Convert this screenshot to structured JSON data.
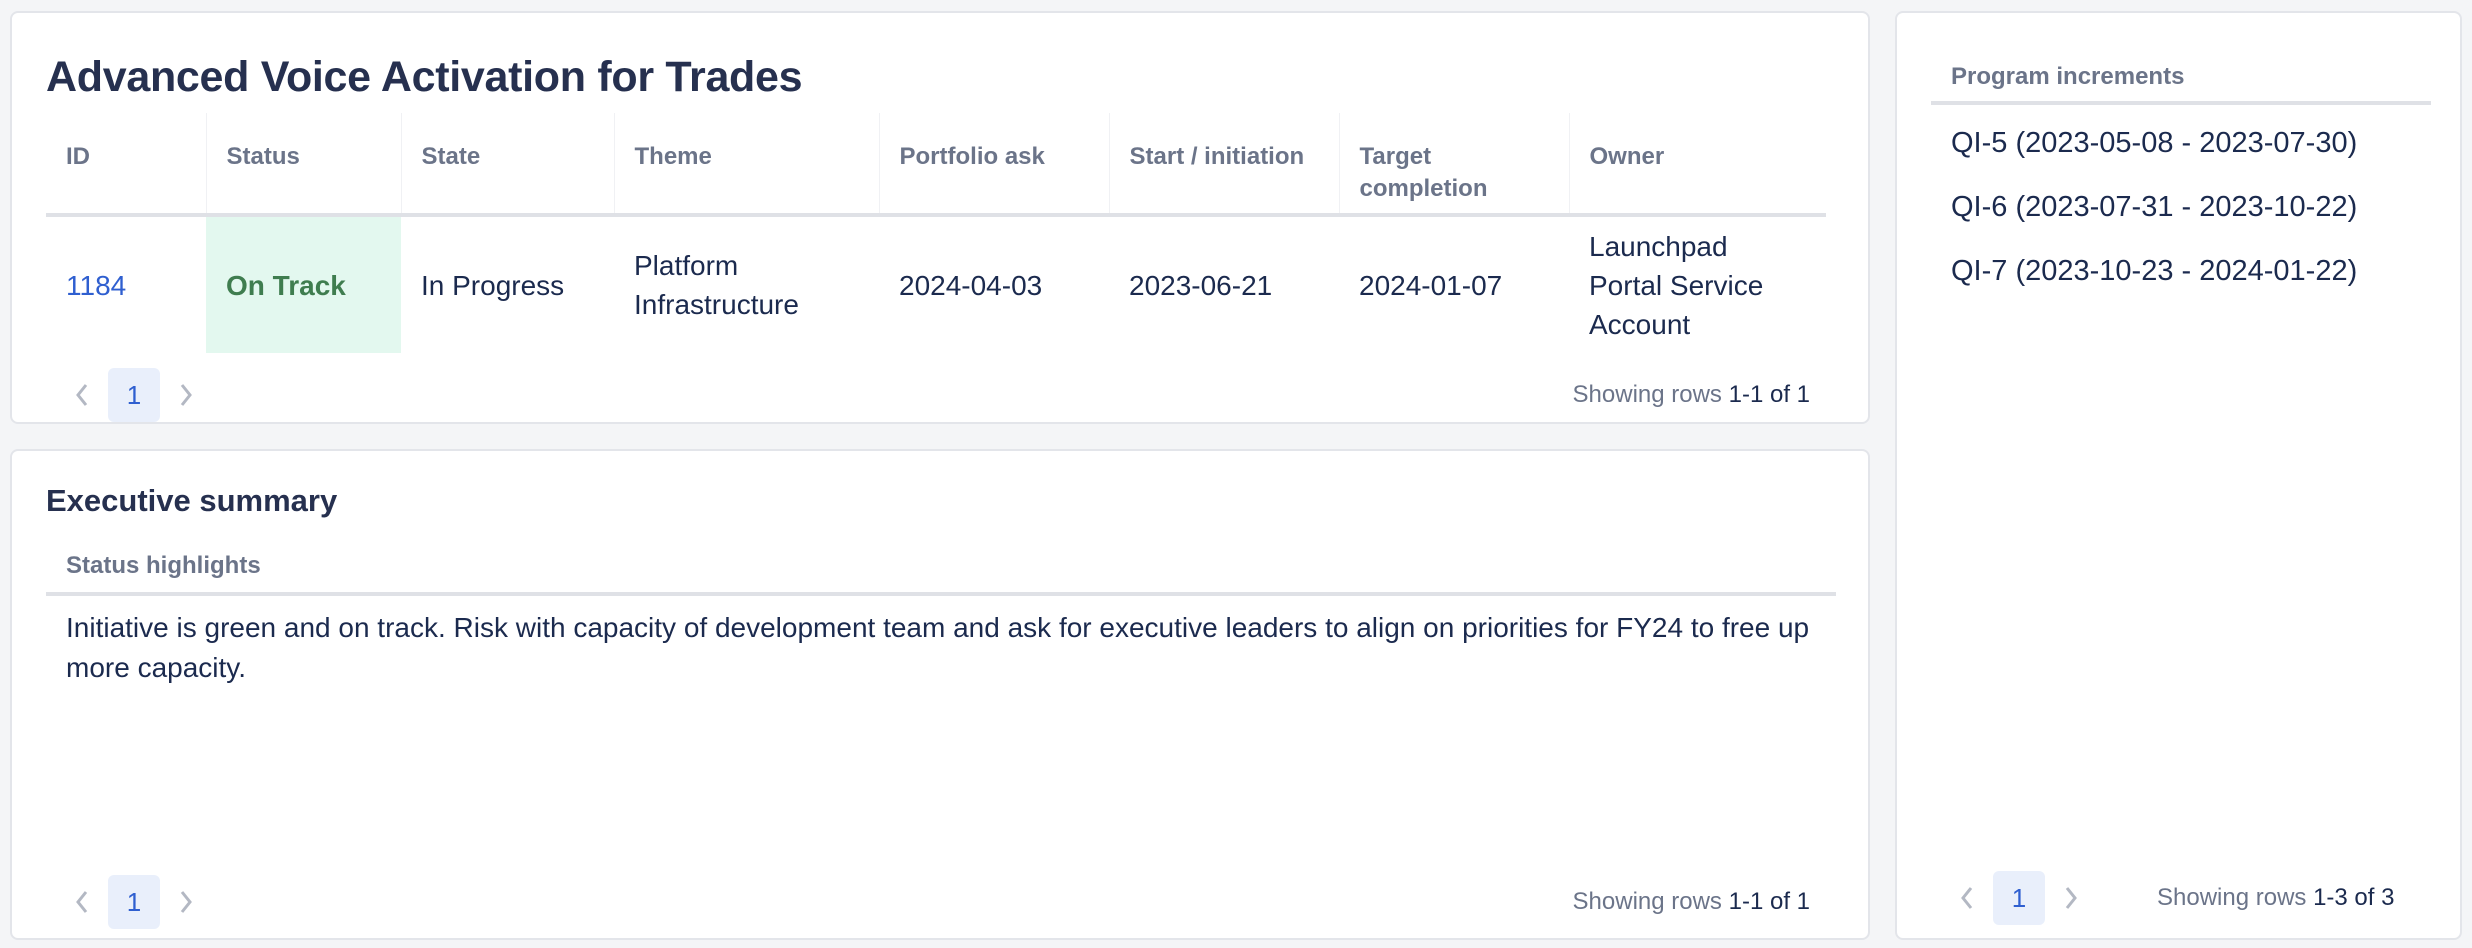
{
  "initiative": {
    "title": "Advanced Voice Activation for Trades",
    "columns": [
      "ID",
      "Status",
      "State",
      "Theme",
      "Portfolio ask",
      "Start / initiation",
      "Target completion",
      "Owner"
    ],
    "rows": [
      {
        "id": "1184",
        "status": "On Track",
        "state": "In Progress",
        "theme": "Platform Infrastructure",
        "portfolio_ask": "2024-04-03",
        "start": "2023-06-21",
        "target": "2024-01-07",
        "owner": "Launchpad Portal Service Account"
      }
    ],
    "pagination": {
      "current_page": "1",
      "rows_label": "Showing rows",
      "rows_range": "1-1 of 1"
    },
    "status_colors": {
      "on_track_bg": "#e3f8ef",
      "on_track_text": "#3f7d4f"
    }
  },
  "summary": {
    "title": "Executive summary",
    "column": "Status highlights",
    "text": "Initiative is green and on track. Risk with capacity of development team and ask for executive leaders to align on priorities for FY24 to free up more capacity.",
    "pagination": {
      "current_page": "1",
      "rows_label": "Showing rows",
      "rows_range": "1-1 of 1"
    }
  },
  "increments": {
    "column": "Program increments",
    "items": [
      "QI-5 (2023-05-08 - 2023-07-30)",
      "QI-6 (2023-07-31 - 2023-10-22)",
      "QI-7 (2023-10-23 - 2024-01-22)"
    ],
    "pagination": {
      "current_page": "1",
      "rows_label": "Showing rows",
      "rows_range": "1-3 of 3"
    }
  },
  "icons": {
    "prev": "chevron-left-icon",
    "next": "chevron-right-icon"
  },
  "accent_color": "#2f5fd0"
}
